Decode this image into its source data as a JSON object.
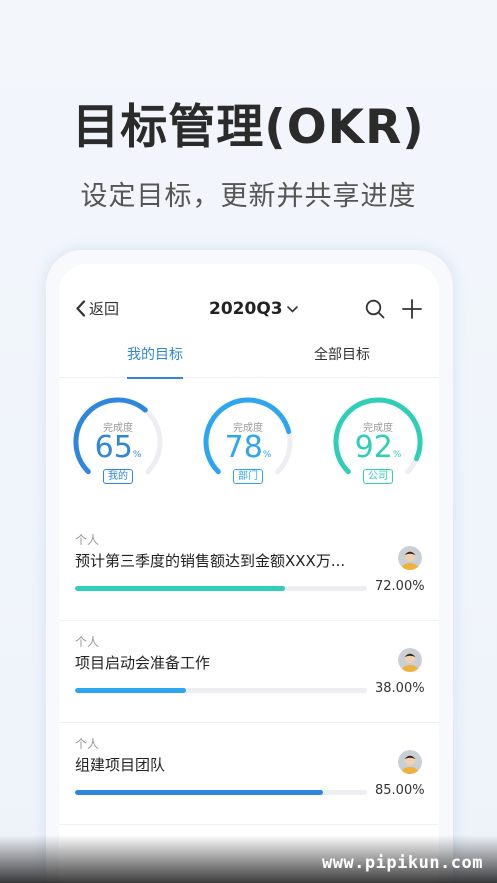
{
  "hero": {
    "title": "目标管理(OKR)",
    "subtitle": "设定目标，更新并共享进度"
  },
  "nav": {
    "back_label": "返回",
    "period": "2020Q3"
  },
  "tabs": [
    {
      "label": "我的目标",
      "active": true
    },
    {
      "label": "全部目标",
      "active": false
    }
  ],
  "gauges": [
    {
      "caption": "完成度",
      "value": 65,
      "unit": "%",
      "tag": "我的",
      "color": "#2f86de"
    },
    {
      "caption": "完成度",
      "value": 78,
      "unit": "%",
      "tag": "部门",
      "color": "#2ea6ef"
    },
    {
      "caption": "完成度",
      "value": 92,
      "unit": "%",
      "tag": "公司",
      "color": "#2fcfb7"
    }
  ],
  "objectives": [
    {
      "type": "个人",
      "title": "预计第三季度的销售额达到金额XXX万...",
      "progress": 0.72,
      "progress_label": "72.00%",
      "color": "#2fcfb7"
    },
    {
      "type": "个人",
      "title": "项目启动会准备工作",
      "progress": 0.38,
      "progress_label": "38.00%",
      "color": "#2ea6ef"
    },
    {
      "type": "个人",
      "title": "组建项目团队",
      "progress": 0.85,
      "progress_label": "85.00%",
      "color": "#2f86de"
    }
  ],
  "watermark": "www.pipikun.com",
  "icons": {
    "back": "chevron-left-icon",
    "dropdown": "chevron-down-icon",
    "search": "search-icon",
    "add": "plus-icon"
  }
}
